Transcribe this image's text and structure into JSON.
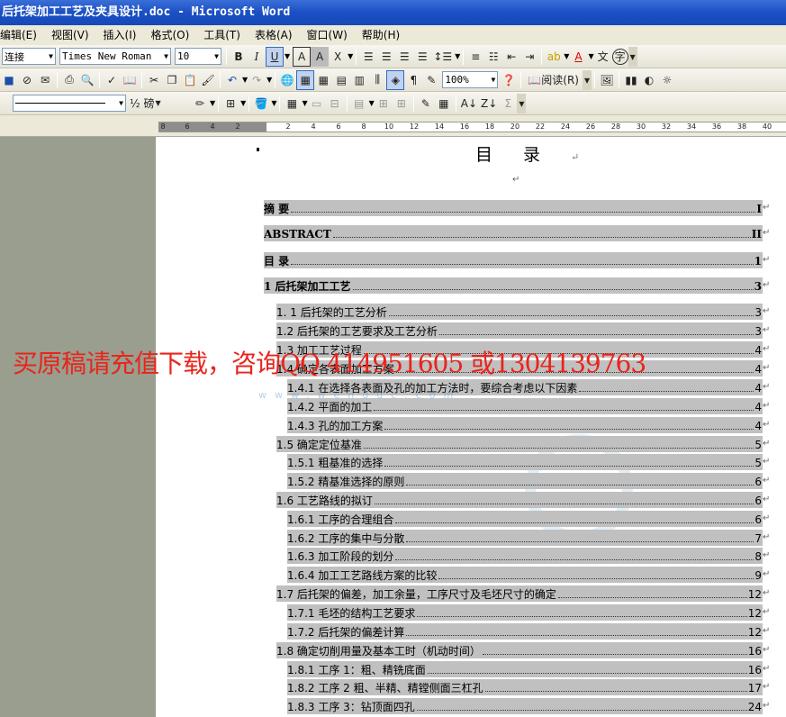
{
  "window": {
    "title": "后托架加工工艺及夹具设计.doc - Microsoft Word"
  },
  "menu": [
    "编辑(E)",
    "视图(V)",
    "插入(I)",
    "格式(O)",
    "工具(T)",
    "表格(A)",
    "窗口(W)",
    "帮助(H)"
  ],
  "formatting_toolbar": {
    "style": "连接",
    "font": "Times New Roman",
    "size": "10",
    "buttons": [
      "B",
      "I",
      "U",
      "A",
      "A",
      "X"
    ]
  },
  "standard_toolbar": {
    "zoom": "100%",
    "read_label": "阅读(R)"
  },
  "drawing_toolbar": {
    "line_weight": "½ 磅",
    "sigma": "Σ"
  },
  "ruler": {
    "ticks": [
      "8",
      "6",
      "4",
      "2",
      "2",
      "4",
      "6",
      "8",
      "10",
      "12",
      "14",
      "16",
      "18",
      "20",
      "22",
      "24",
      "26",
      "28",
      "30",
      "32",
      "34",
      "36",
      "38",
      "40"
    ]
  },
  "document": {
    "title": "目录",
    "para_mark": "↵",
    "toc": [
      {
        "text": "摘    要",
        "page": "I",
        "level": 0,
        "bold": true
      },
      {
        "text": "ABSTRACT",
        "page": "II",
        "level": 0,
        "bold": true
      },
      {
        "text": "目    录",
        "page": "1",
        "level": 0,
        "bold": true
      },
      {
        "text": "1   后托架加工工艺",
        "page": "3",
        "level": 0,
        "bold": true
      },
      {
        "text": "1. 1  后托架的工艺分析",
        "page": "3",
        "level": 1,
        "bold": false
      },
      {
        "text": "1.2  后托架的工艺要求及工艺分析",
        "page": "3",
        "level": 1,
        "bold": false
      },
      {
        "text": "1.3  加工工艺过程",
        "page": "4",
        "level": 1,
        "bold": false
      },
      {
        "text": "1.4  确定各表面加工方案",
        "page": "4",
        "level": 1,
        "bold": false
      },
      {
        "text": "1.4.1  在选择各表面及孔的加工方法时，要综合考虑以下因素",
        "page": "4",
        "level": 2,
        "bold": false
      },
      {
        "text": "1.4.2  平面的加工",
        "page": "4",
        "level": 2,
        "bold": false
      },
      {
        "text": "1.4.3 孔的加工方案",
        "page": "4",
        "level": 2,
        "bold": false
      },
      {
        "text": "1.5  确定定位基准",
        "page": "5",
        "level": 1,
        "bold": false
      },
      {
        "text": "1.5.1  粗基准的选择",
        "page": "5",
        "level": 2,
        "bold": false
      },
      {
        "text": "1.5.2  精基准选择的原则",
        "page": "6",
        "level": 2,
        "bold": false
      },
      {
        "text": "1.6  工艺路线的拟订",
        "page": "6",
        "level": 1,
        "bold": false
      },
      {
        "text": "1.6.1 工序的合理组合",
        "page": "6",
        "level": 2,
        "bold": false
      },
      {
        "text": "1.6.2  工序的集中与分散",
        "page": "7",
        "level": 2,
        "bold": false
      },
      {
        "text": "1.6.3  加工阶段的划分",
        "page": "8",
        "level": 2,
        "bold": false
      },
      {
        "text": "1.6.4  加工工艺路线方案的比较",
        "page": "9",
        "level": 2,
        "bold": false
      },
      {
        "text": "1.7  后托架的偏差，加工余量，工序尺寸及毛坯尺寸的确定",
        "page": "12",
        "level": 1,
        "bold": false
      },
      {
        "text": "1.7.1  毛坯的结构工艺要求",
        "page": "12",
        "level": 2,
        "bold": false
      },
      {
        "text": "1.7.2  后托架的偏差计算",
        "page": "12",
        "level": 2,
        "bold": false
      },
      {
        "text": "1.8  确定切削用量及基本工时（机动时间）",
        "page": "16",
        "level": 1,
        "bold": false
      },
      {
        "text": "1.8.1  工序 1：粗、精铣底面",
        "page": "16",
        "level": 2,
        "bold": false
      },
      {
        "text": "1.8.2  工序 2    粗、半精、精镗侧面三杠孔",
        "page": "17",
        "level": 2,
        "bold": false
      },
      {
        "text": "1.8.3  工序 3：钻顶面四孔",
        "page": "24",
        "level": 2,
        "bold": false
      }
    ]
  },
  "overlay": {
    "watermark": "买原稿请充值下载，咨询QQ  414951605  或1304139763",
    "site": "www.wenduc.com"
  }
}
